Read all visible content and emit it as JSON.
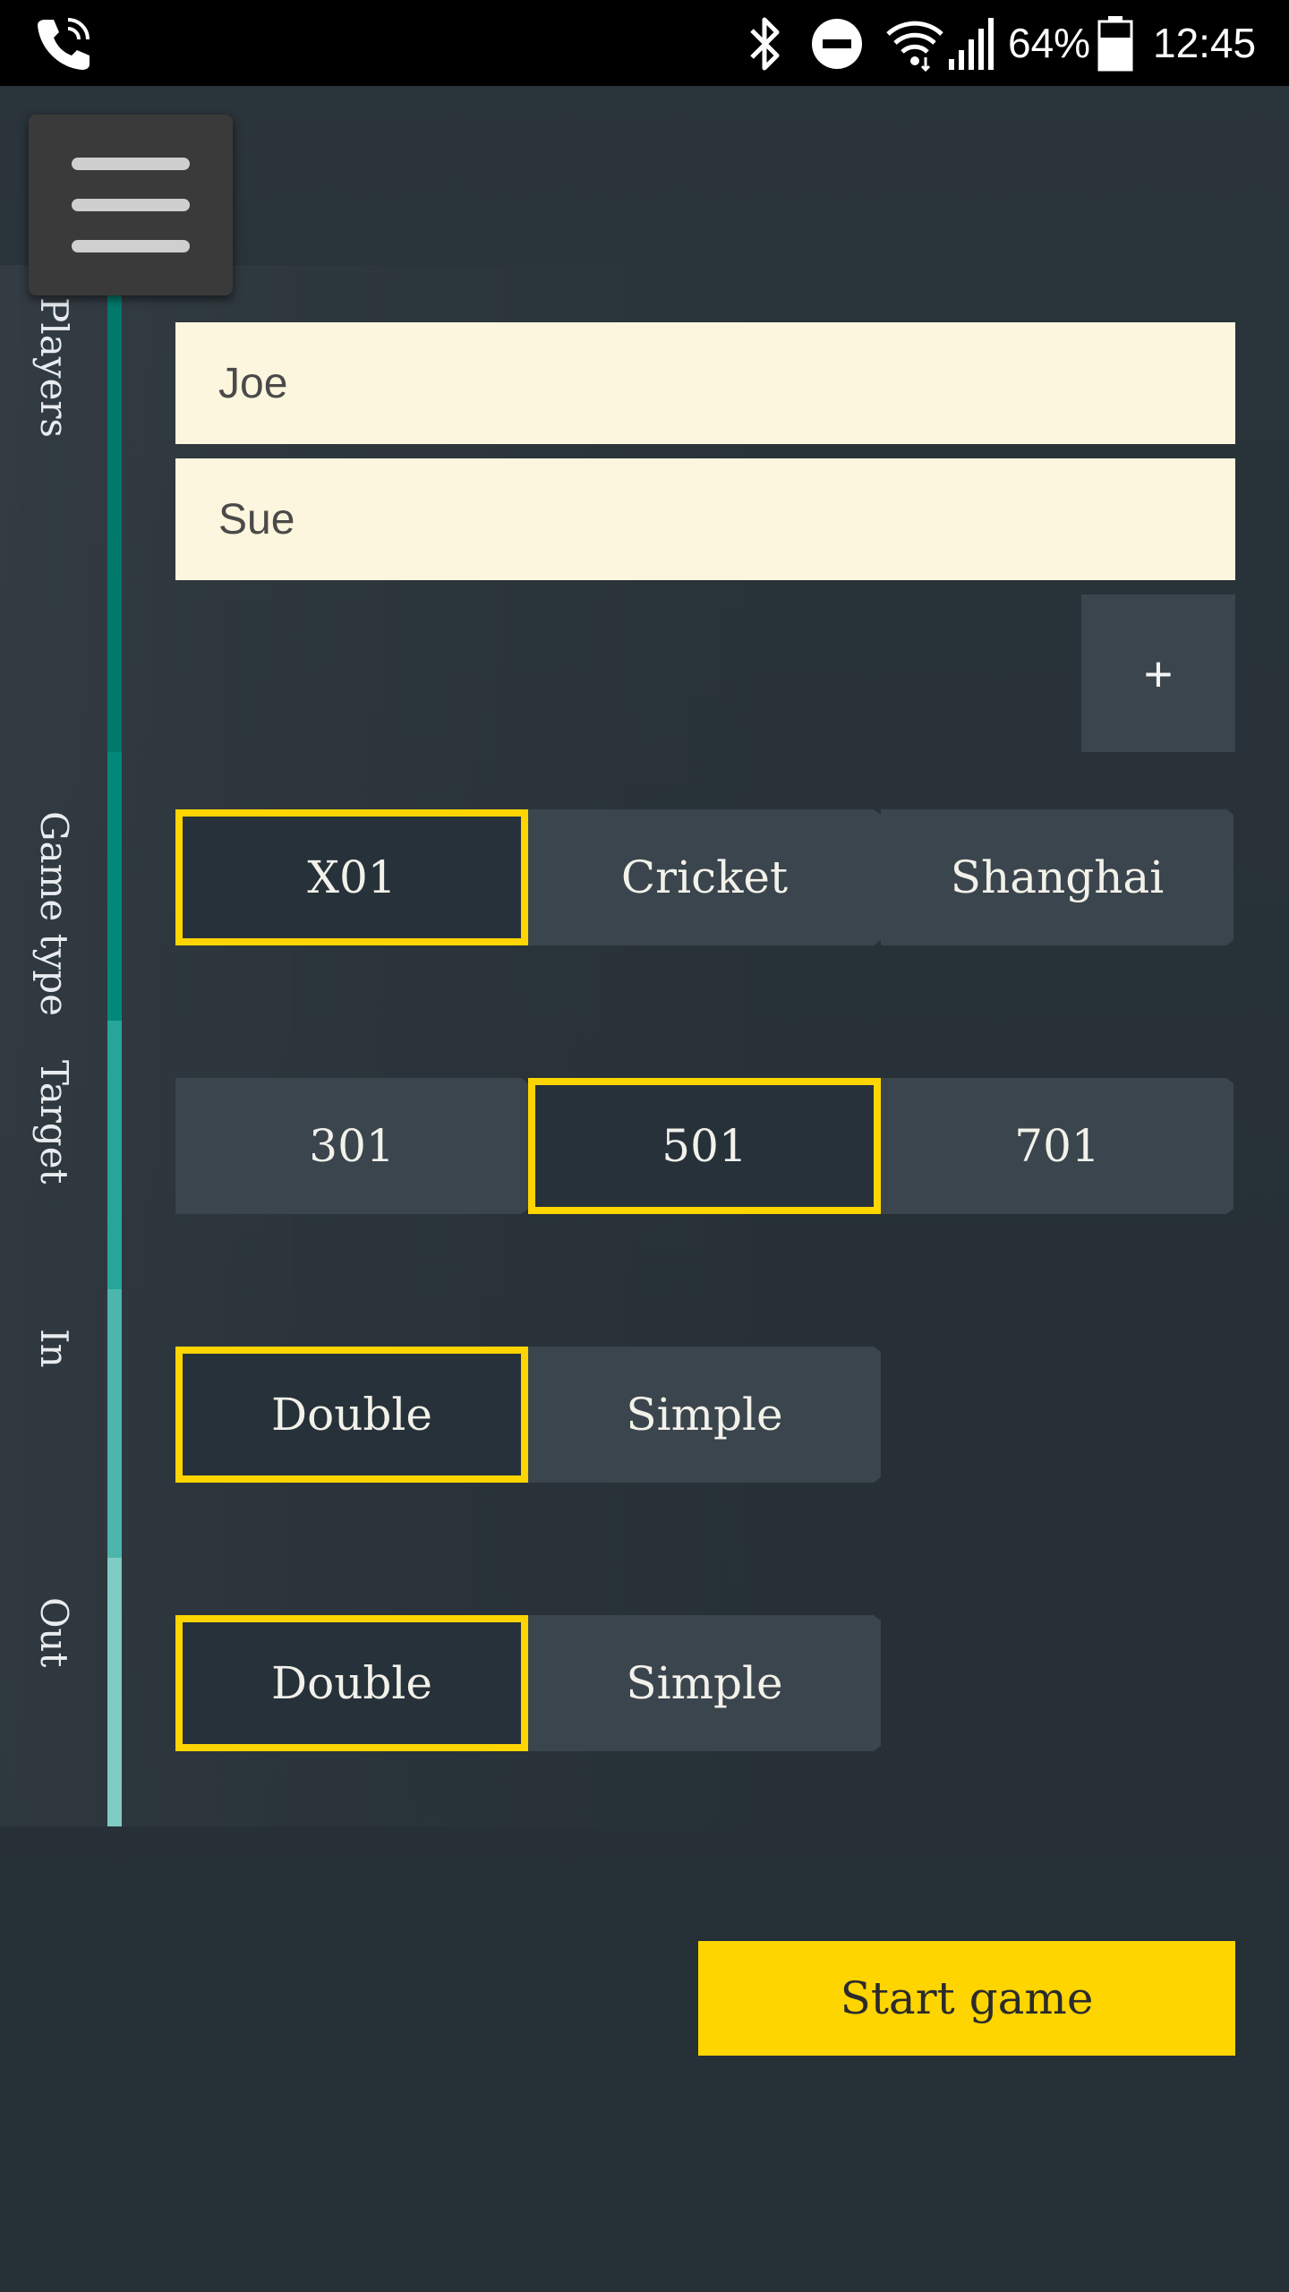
{
  "status_bar": {
    "icons": [
      "phone-wifi-call-icon",
      "bluetooth-icon",
      "do-not-disturb-icon",
      "wifi-icon",
      "cell-signal-icon",
      "battery-icon"
    ],
    "battery": "64%",
    "time": "12:45"
  },
  "menu": {
    "icon": "hamburger-menu-icon"
  },
  "players": {
    "label": "Players",
    "list": [
      "Joe",
      "Sue"
    ],
    "add_label": "+"
  },
  "game_type": {
    "label": "Game type",
    "options": [
      "X01",
      "Cricket",
      "Shanghai"
    ],
    "selected": "X01"
  },
  "target": {
    "label": "Target",
    "options": [
      "301",
      "501",
      "701"
    ],
    "selected": "501"
  },
  "in": {
    "label": "In",
    "options": [
      "Double",
      "Simple"
    ],
    "selected": "Double"
  },
  "out": {
    "label": "Out",
    "options": [
      "Double",
      "Simple"
    ],
    "selected": "Double"
  },
  "start_label": "Start game",
  "colors": {
    "background": "#263138",
    "option_bg": "#3b454d",
    "selected_border": "#ffd500",
    "input_bg": "#fdf6de",
    "accent_button": "#ffd500",
    "rail_players": "#00796b",
    "rail_game_type": "#00897b",
    "rail_target": "#26a69a",
    "rail_in": "#4db6ac",
    "rail_out": "#80cbc4"
  }
}
